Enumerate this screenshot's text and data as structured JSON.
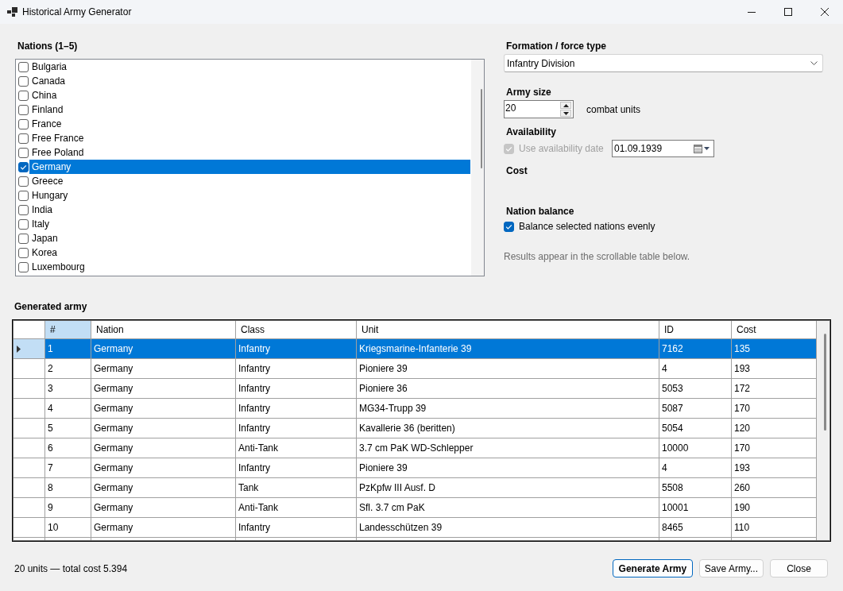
{
  "window": {
    "title": "Historical Army Generator"
  },
  "nations": {
    "label": "Nations (1–5)",
    "items": [
      {
        "name": "Bulgaria",
        "checked": false,
        "selected": false
      },
      {
        "name": "Canada",
        "checked": false,
        "selected": false
      },
      {
        "name": "China",
        "checked": false,
        "selected": false
      },
      {
        "name": "Finland",
        "checked": false,
        "selected": false
      },
      {
        "name": "France",
        "checked": false,
        "selected": false
      },
      {
        "name": "Free France",
        "checked": false,
        "selected": false
      },
      {
        "name": "Free Poland",
        "checked": false,
        "selected": false
      },
      {
        "name": "Germany",
        "checked": true,
        "selected": true
      },
      {
        "name": "Greece",
        "checked": false,
        "selected": false
      },
      {
        "name": "Hungary",
        "checked": false,
        "selected": false
      },
      {
        "name": "India",
        "checked": false,
        "selected": false
      },
      {
        "name": "Italy",
        "checked": false,
        "selected": false
      },
      {
        "name": "Japan",
        "checked": false,
        "selected": false
      },
      {
        "name": "Korea",
        "checked": false,
        "selected": false
      },
      {
        "name": "Luxembourg",
        "checked": false,
        "selected": false
      }
    ]
  },
  "formation": {
    "label": "Formation / force type",
    "value": "Infantry Division"
  },
  "army_size": {
    "label": "Army size",
    "value": "20",
    "unit": "combat units"
  },
  "availability": {
    "label": "Availability",
    "use_date": {
      "label": "Use availability date",
      "checked": true,
      "disabled": true
    },
    "date": "01.09.1939"
  },
  "cost": {
    "label": "Cost"
  },
  "nation_balance": {
    "label": "Nation balance",
    "balance": {
      "label": "Balance selected nations evenly",
      "checked": true
    }
  },
  "hint": "Results appear in the scrollable table below.",
  "army": {
    "label": "Generated army",
    "columns": [
      {
        "label": "#",
        "selected": true
      },
      {
        "label": "Nation",
        "selected": false
      },
      {
        "label": "Class",
        "selected": false
      },
      {
        "label": "Unit",
        "selected": false
      },
      {
        "label": "ID",
        "selected": false
      },
      {
        "label": "Cost",
        "selected": false
      }
    ],
    "rows": [
      {
        "selected": true,
        "cells": [
          "1",
          "Germany",
          "Infantry",
          "Kriegsmarine-Infanterie 39",
          "7162",
          "135"
        ]
      },
      {
        "selected": false,
        "cells": [
          "2",
          "Germany",
          "Infantry",
          "Pioniere 39",
          "4",
          "193"
        ]
      },
      {
        "selected": false,
        "cells": [
          "3",
          "Germany",
          "Infantry",
          "Pioniere 36",
          "5053",
          "172"
        ]
      },
      {
        "selected": false,
        "cells": [
          "4",
          "Germany",
          "Infantry",
          "MG34-Trupp 39",
          "5087",
          "170"
        ]
      },
      {
        "selected": false,
        "cells": [
          "5",
          "Germany",
          "Infantry",
          "Kavallerie 36 (beritten)",
          "5054",
          "120"
        ]
      },
      {
        "selected": false,
        "cells": [
          "6",
          "Germany",
          "Anti-Tank",
          "3.7 cm PaK WD-Schlepper",
          "10000",
          "170"
        ]
      },
      {
        "selected": false,
        "cells": [
          "7",
          "Germany",
          "Infantry",
          "Pioniere 39",
          "4",
          "193"
        ]
      },
      {
        "selected": false,
        "cells": [
          "8",
          "Germany",
          "Tank",
          "PzKpfw III Ausf. D",
          "5508",
          "260"
        ]
      },
      {
        "selected": false,
        "cells": [
          "9",
          "Germany",
          "Anti-Tank",
          "Sfl. 3.7 cm PaK",
          "10001",
          "190"
        ]
      },
      {
        "selected": false,
        "cells": [
          "10",
          "Germany",
          "Infantry",
          "Landesschützen 39",
          "8465",
          "110"
        ]
      }
    ]
  },
  "status": "20 units — total cost 5.394",
  "buttons": [
    {
      "label": "Generate Army",
      "default": true
    },
    {
      "label": "Save Army...",
      "default": false
    },
    {
      "label": "Close",
      "default": false
    }
  ]
}
